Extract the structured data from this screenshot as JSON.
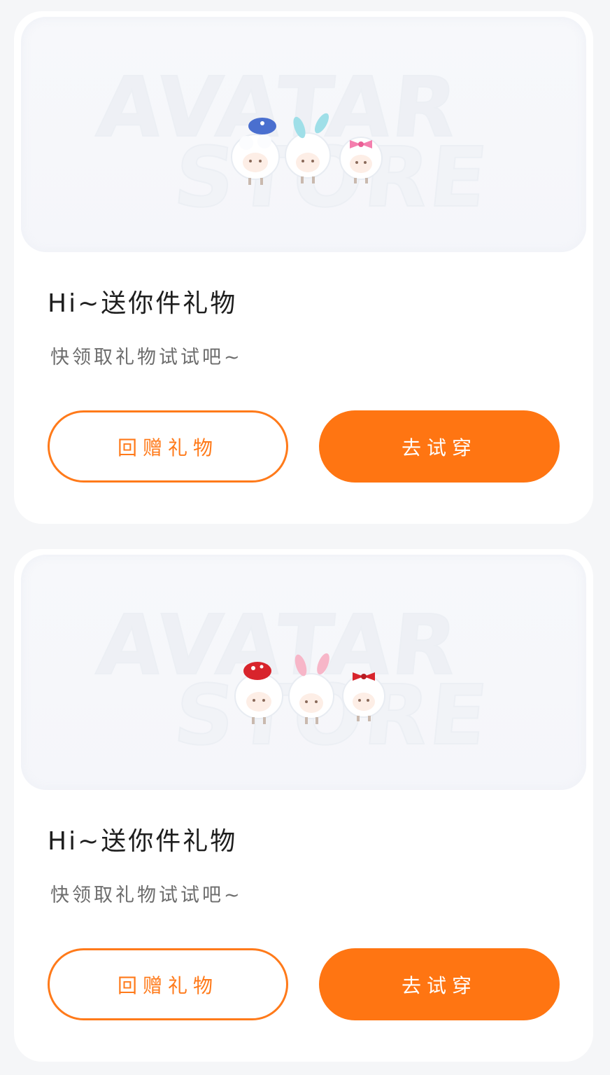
{
  "cards": [
    {
      "banner": {
        "watermark_line1": "AVATAR",
        "watermark_line2": "STORE",
        "theme": "blue"
      },
      "title": "Hi~送你件礼物",
      "subtitle": "快领取礼物试试吧~",
      "return_gift_label": "回赠礼物",
      "try_on_label": "去试穿"
    },
    {
      "banner": {
        "watermark_line1": "AVATAR",
        "watermark_line2": "STORE",
        "theme": "red"
      },
      "title": "Hi~送你件礼物",
      "subtitle": "快领取礼物试试吧~",
      "return_gift_label": "回赠礼物",
      "try_on_label": "去试穿"
    }
  ],
  "colors": {
    "accent": "#ff7512",
    "outline_text": "#ff7a1a",
    "background": "#f5f6f8",
    "card": "#ffffff"
  },
  "icons": [
    "sheep-avatar-icon"
  ]
}
